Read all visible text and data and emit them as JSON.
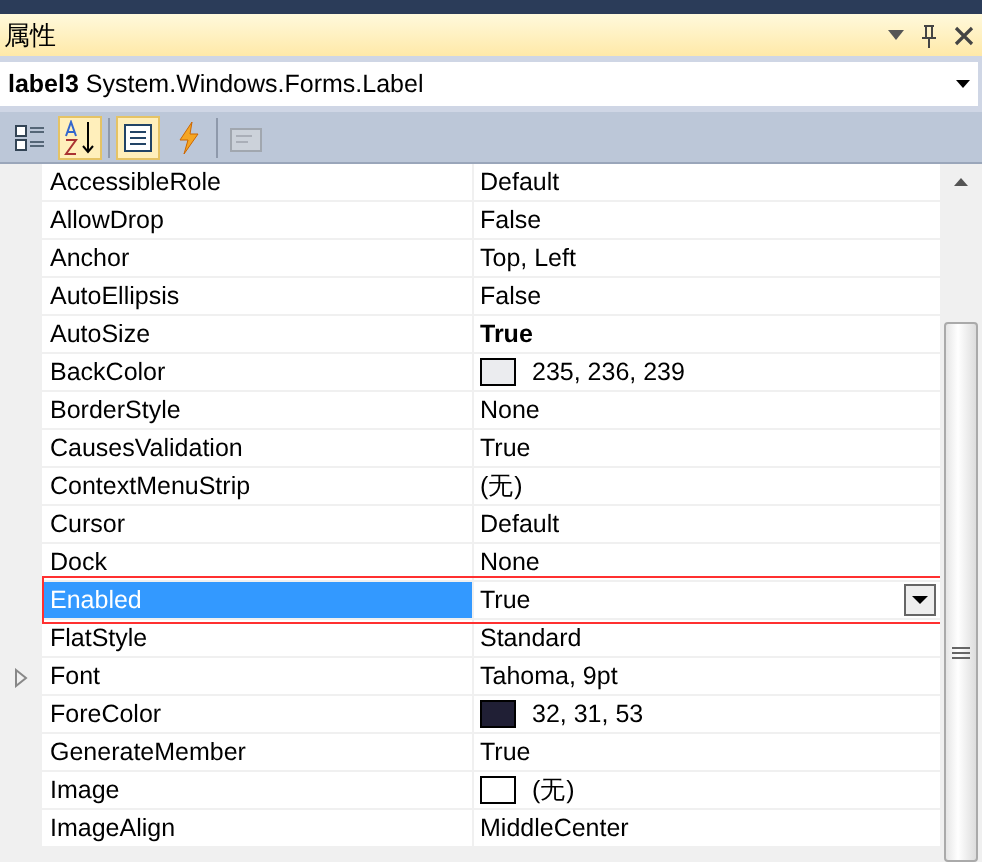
{
  "window": {
    "title": "属性"
  },
  "object_selector": {
    "name": "label3",
    "type": "System.Windows.Forms.Label"
  },
  "toolbar": [
    {
      "kind": "categorized",
      "selected": false,
      "disabled": false
    },
    {
      "kind": "alphabetical",
      "selected": true,
      "disabled": false
    },
    {
      "kind": "properties",
      "selected": true,
      "disabled": false
    },
    {
      "kind": "events",
      "selected": false,
      "disabled": false
    },
    {
      "kind": "pages",
      "selected": false,
      "disabled": true
    }
  ],
  "properties": [
    {
      "name": "AccessibleRole",
      "value": "Default",
      "selected": false,
      "bold": false
    },
    {
      "name": "AllowDrop",
      "value": "False",
      "selected": false,
      "bold": false
    },
    {
      "name": "Anchor",
      "value": "Top, Left",
      "selected": false,
      "bold": false
    },
    {
      "name": "AutoEllipsis",
      "value": "False",
      "selected": false,
      "bold": false
    },
    {
      "name": "AutoSize",
      "value": "True",
      "selected": false,
      "bold": true
    },
    {
      "name": "BackColor",
      "value": "235, 236, 239",
      "selected": false,
      "bold": false,
      "color": "#ebecef"
    },
    {
      "name": "BorderStyle",
      "value": "None",
      "selected": false,
      "bold": false
    },
    {
      "name": "CausesValidation",
      "value": "True",
      "selected": false,
      "bold": false
    },
    {
      "name": "ContextMenuStrip",
      "value": "(无)",
      "selected": false,
      "bold": false
    },
    {
      "name": "Cursor",
      "value": "Default",
      "selected": false,
      "bold": false
    },
    {
      "name": "Dock",
      "value": "None",
      "selected": false,
      "bold": false
    },
    {
      "name": "Enabled",
      "value": "True",
      "selected": true,
      "bold": false,
      "highlighted": true
    },
    {
      "name": "FlatStyle",
      "value": "Standard",
      "selected": false,
      "bold": false
    },
    {
      "name": "Font",
      "value": "Tahoma, 9pt",
      "selected": false,
      "bold": false,
      "expanded": false
    },
    {
      "name": "ForeColor",
      "value": "32, 31, 53",
      "selected": false,
      "bold": false,
      "color": "#201f35"
    },
    {
      "name": "GenerateMember",
      "value": "True",
      "selected": false,
      "bold": false
    },
    {
      "name": "Image",
      "value": "(无)",
      "selected": false,
      "bold": false,
      "color": "#ffffff"
    },
    {
      "name": "ImageAlign",
      "value": "MiddleCenter",
      "selected": false,
      "bold": false
    }
  ]
}
